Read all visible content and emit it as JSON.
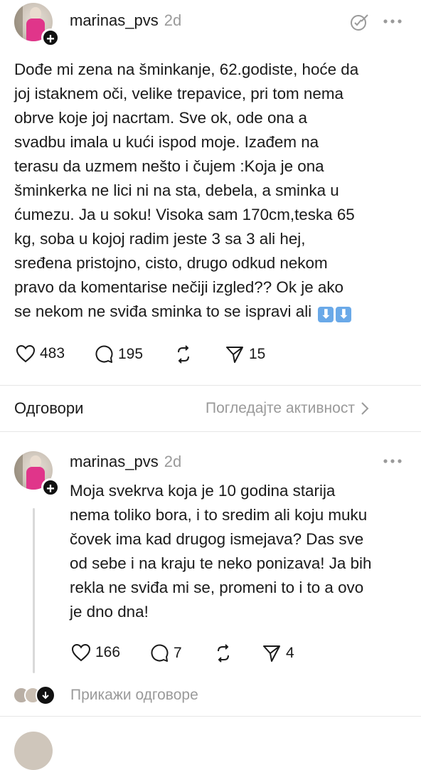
{
  "post": {
    "username": "marinas_pvs",
    "time": "2d",
    "lines": [
      "Dođe mi zena na šminkanje, 62.godiste, hoće da",
      "joj istaknem oči, velike trepavice, pri tom nema",
      "obrve koje joj nacrtam. Sve ok, ode ona a",
      "svadbu imala u kući ispod moje. Izađem na",
      "terasu da uzmem nešto i čujem :Koja je ona",
      "šminkerka ne lici ni na sta, debela, a sminka u",
      "ćumezu. Ja u soku! Visoka sam 170cm,teska 65",
      "kg, soba u kojoj radim jeste 3 sa 3 ali hej,",
      "sređena pristojno, cisto, drugo odkud nekom",
      "pravo da komentarise nečiji izgled?? Ok je ako",
      "se nekom ne sviđa sminka to se ispravi ali"
    ],
    "emoji_arrows": [
      "⬇",
      "⬇"
    ],
    "likes": "483",
    "replies": "195",
    "reposts": "",
    "shares": "15"
  },
  "replies_header": {
    "label": "Одговори",
    "activity": "Погледајте активност"
  },
  "reply": {
    "username": "marinas_pvs",
    "time": "2d",
    "lines": [
      "Moja svekrva koja je 10 godina starija",
      "nema toliko bora, i to sredim ali koju muku",
      "čovek ima kad drugog ismejava? Das sve",
      "od sebe i na kraju te neko ponizava! Ja bih",
      "rekla ne sviđa mi se, promeni to i to a ovo",
      "je dno dna!"
    ],
    "likes": "166",
    "replies": "7",
    "shares": "4",
    "show_replies": "Прикажи одговоре"
  },
  "colors": {
    "accent_pink": "#e0358a",
    "muted_gray": "#9a9a9a",
    "arrow_emoji_blue": "#6aa9e8"
  },
  "icons": [
    "plus-icon",
    "feed-settings-icon",
    "more-icon",
    "heart-icon",
    "comment-icon",
    "repost-icon",
    "share-icon",
    "chevron-right-icon",
    "arrow-down-icon"
  ]
}
